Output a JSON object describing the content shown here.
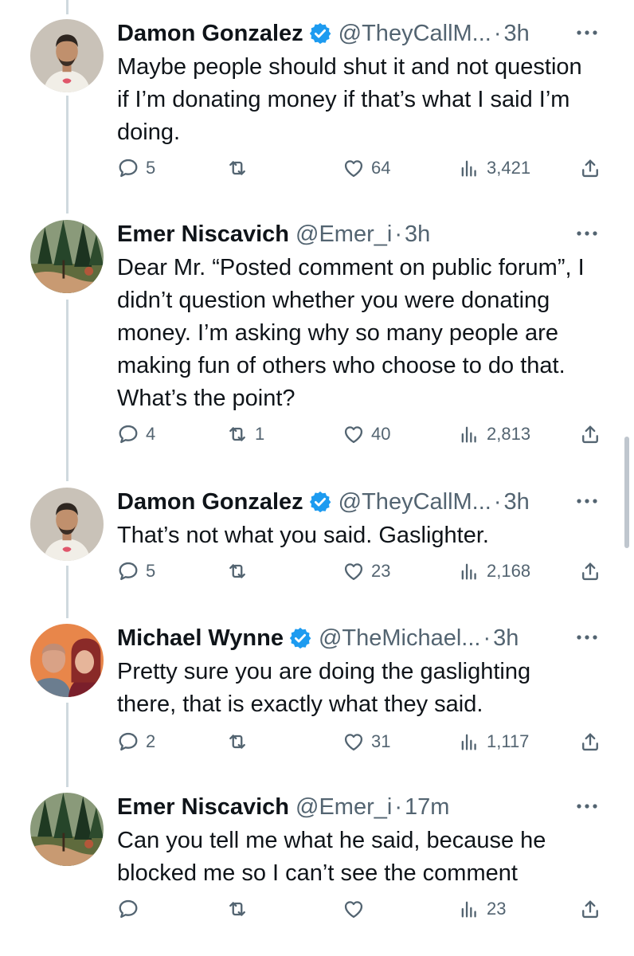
{
  "tweets": [
    {
      "name": "Damon Gonzalez",
      "verified": true,
      "handle": "@TheyCallM...",
      "time": "3h",
      "avatar": "avatar-man-white-shirt",
      "text": "Maybe people should shut it and not question if I’m donating money if that’s what I said I’m doing.",
      "replies": "5",
      "retweets": "",
      "likes": "64",
      "views": "3,421"
    },
    {
      "name": "Emer Niscavich",
      "verified": false,
      "handle": "@Emer_i",
      "time": "3h",
      "avatar": "avatar-forest",
      "text": "Dear Mr. “Posted comment on public forum”, I didn’t question whether you were donating money. I’m asking why so many people are making fun of others who choose to do that. What’s the point?",
      "replies": "4",
      "retweets": "1",
      "likes": "40",
      "views": "2,813"
    },
    {
      "name": "Damon Gonzalez",
      "verified": true,
      "handle": "@TheyCallM...",
      "time": "3h",
      "avatar": "avatar-man-white-shirt",
      "text": "That’s not what you said. Gaslighter.",
      "replies": "5",
      "retweets": "",
      "likes": "23",
      "views": "2,168"
    },
    {
      "name": "Michael Wynne",
      "verified": true,
      "handle": "@TheMichael...",
      "time": "3h",
      "avatar": "avatar-couple",
      "text": "Pretty sure you are doing the gaslighting there, that is exactly what they said.",
      "replies": "2",
      "retweets": "",
      "likes": "31",
      "views": "1,117"
    },
    {
      "name": "Emer Niscavich",
      "verified": false,
      "handle": "@Emer_i",
      "time": "17m",
      "avatar": "avatar-forest",
      "text": "Can you tell me what he said, because he blocked me so I can’t see the comment",
      "replies": "",
      "retweets": "",
      "likes": "",
      "views": "23"
    }
  ],
  "separator": "·",
  "colors": {
    "verified": "#1d9bf0",
    "muted": "#536471",
    "thread_line": "#cfd9de"
  },
  "icons": [
    "reply-icon",
    "retweet-icon",
    "like-icon",
    "views-icon",
    "share-icon",
    "more-icon",
    "verified-badge-icon"
  ]
}
